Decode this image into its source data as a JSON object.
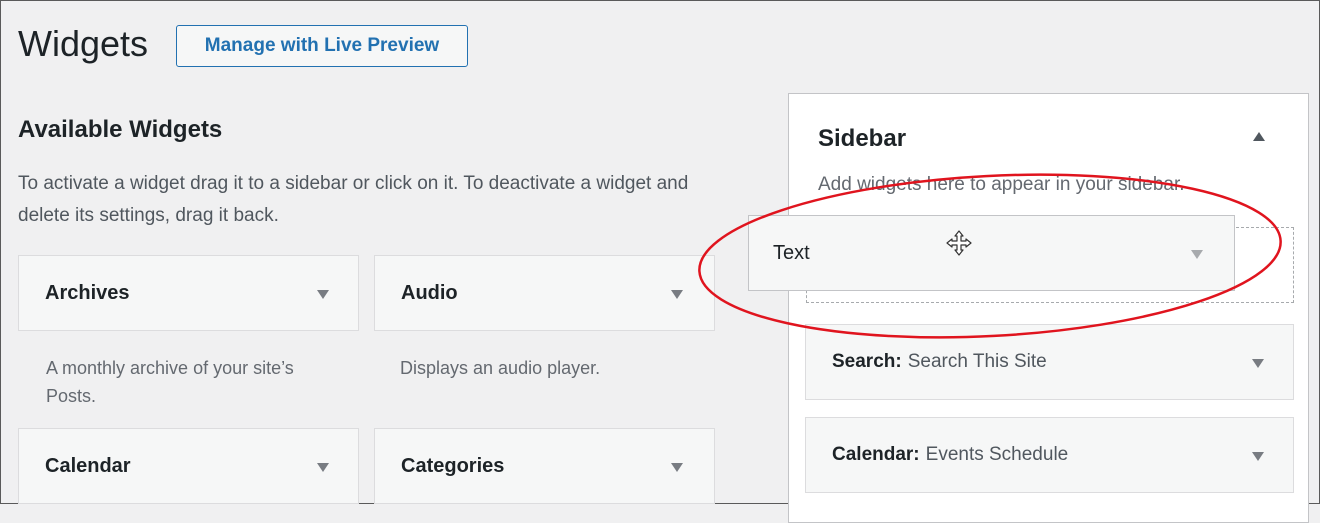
{
  "header": {
    "title": "Widgets",
    "live_preview_label": "Manage with Live Preview"
  },
  "available": {
    "title": "Available Widgets",
    "description": "To activate a widget drag it to a sidebar or click on it. To deactivate a widget and delete its settings, drag it back.",
    "widgets": [
      {
        "name": "Archives",
        "description": "A monthly archive of your site’s Posts."
      },
      {
        "name": "Audio",
        "description": "Displays an audio player."
      },
      {
        "name": "Calendar",
        "description": ""
      },
      {
        "name": "Categories",
        "description": ""
      }
    ]
  },
  "sidebar": {
    "title": "Sidebar",
    "description": "Add widgets here to appear in your sidebar.",
    "widgets": [
      {
        "type": "Search:",
        "title": "Search This Site"
      },
      {
        "type": "Calendar:",
        "title": "Events Schedule"
      }
    ]
  },
  "dragging": {
    "name": "Text"
  },
  "colors": {
    "accent": "#2271b1",
    "annotation": "#e0141e",
    "background": "#f0f0f1"
  }
}
